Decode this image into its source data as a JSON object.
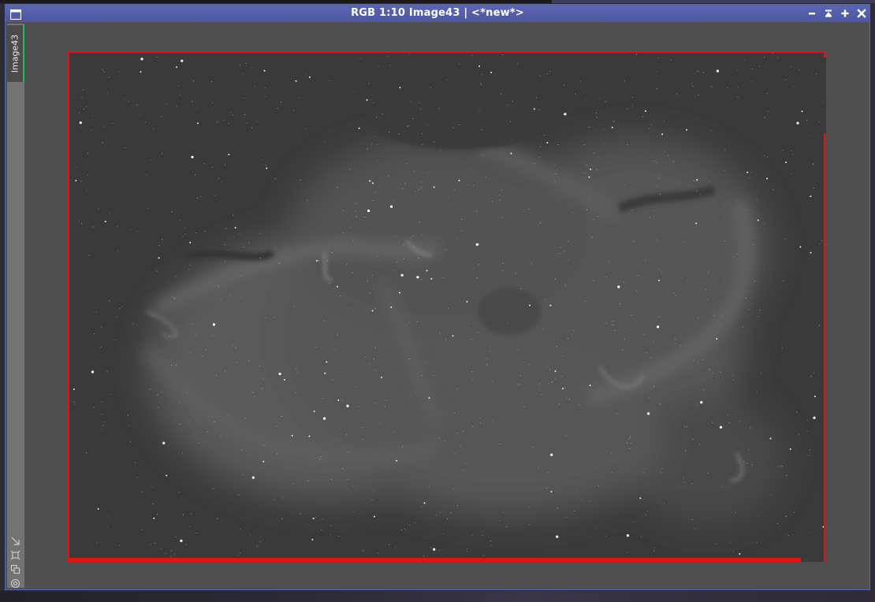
{
  "window": {
    "title": "RGB 1:10 Image43 | <*new*>",
    "controls": {
      "minimize": "minimize-icon",
      "shade": "shade-icon",
      "maximize": "maximize-icon",
      "close": "close-icon"
    }
  },
  "sidebar": {
    "tab_label": "Image43",
    "tab_accent_color": "#21b85a",
    "icons": [
      "resize-arrow-icon",
      "fit-view-icon",
      "clone-view-icon",
      "preview-icon"
    ]
  },
  "image": {
    "subject": "H-alpha nebula (grayscale)",
    "edge_color": "#e81010",
    "background_color": "#3c3c3c"
  },
  "colors": {
    "titlebar": "#5b66b3",
    "window_bg": "#4f4f4f",
    "sidebar_bg": "#737373"
  }
}
